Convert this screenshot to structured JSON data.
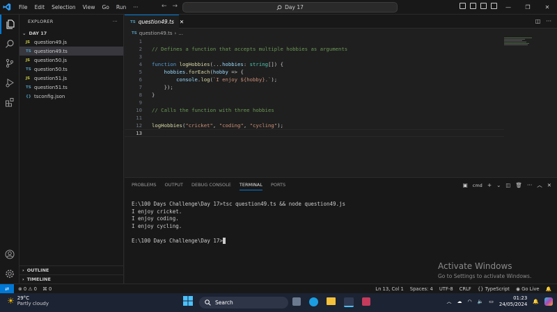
{
  "titlebar": {
    "menu": [
      "File",
      "Edit",
      "Selection",
      "View",
      "Go",
      "Run",
      "···"
    ],
    "search": "Day 17"
  },
  "sidebar": {
    "header": "EXPLORER",
    "folder": "DAY 17",
    "files": [
      {
        "name": "question49.js",
        "type": "JS"
      },
      {
        "name": "question49.ts",
        "type": "TS",
        "selected": true
      },
      {
        "name": "question50.js",
        "type": "JS"
      },
      {
        "name": "question50.ts",
        "type": "TS"
      },
      {
        "name": "question51.js",
        "type": "JS"
      },
      {
        "name": "question51.ts",
        "type": "TS"
      },
      {
        "name": "tsconfig.json",
        "type": "{}"
      }
    ],
    "outline": "OUTLINE",
    "timeline": "TIMELINE"
  },
  "editor": {
    "tab_label": "question49.ts",
    "tab_type": "TS",
    "breadcrumb_file": "question49.ts",
    "breadcrumb_more": "...",
    "lines": [
      {
        "n": "1",
        "text": ""
      },
      {
        "n": "2",
        "text": "// Defines a function that accepts multiple hobbies as arguments"
      },
      {
        "n": "3",
        "text": ""
      },
      {
        "n": "4",
        "text": "function logHobbies(...hobbies: string[]) {"
      },
      {
        "n": "5",
        "text": "    hobbies.forEach(hobby => {"
      },
      {
        "n": "6",
        "text": "        console.log(`I enjoy ${hobby}.`);"
      },
      {
        "n": "7",
        "text": "    });"
      },
      {
        "n": "8",
        "text": "}"
      },
      {
        "n": "9",
        "text": ""
      },
      {
        "n": "10",
        "text": "// Calls the function with three hobbies"
      },
      {
        "n": "11",
        "text": ""
      },
      {
        "n": "12",
        "text": "logHobbies(\"cricket\", \"coding\", \"cycling\");"
      },
      {
        "n": "13",
        "text": ""
      }
    ]
  },
  "panel": {
    "tabs": [
      "PROBLEMS",
      "OUTPUT",
      "DEBUG CONSOLE",
      "TERMINAL",
      "PORTS"
    ],
    "active_tab": "TERMINAL",
    "shell": "cmd",
    "terminal_lines": [
      "E:\\100 Days Challenge\\Day 17>tsc question49.ts && node question49.js",
      "I enjoy cricket.",
      "I enjoy coding.",
      "I enjoy cycling.",
      "",
      "E:\\100 Days Challenge\\Day 17>"
    ]
  },
  "watermark": {
    "title": "Activate Windows",
    "subtitle": "Go to Settings to activate Windows."
  },
  "statusbar": {
    "errors": "0",
    "warnings": "0",
    "ports": "0",
    "position": "Ln 13, Col 1",
    "spaces": "Spaces: 4",
    "encoding": "UTF-8",
    "eol": "CRLF",
    "language": "TypeScript",
    "golive": "Go Live"
  },
  "taskbar": {
    "temp": "29°C",
    "condition": "Partly cloudy",
    "search": "Search",
    "time": "01:23",
    "date": "24/05/2024"
  },
  "colors": {
    "accent": "#0078d4",
    "editor_bg": "#1f1f1f",
    "sidebar_bg": "#181818"
  }
}
